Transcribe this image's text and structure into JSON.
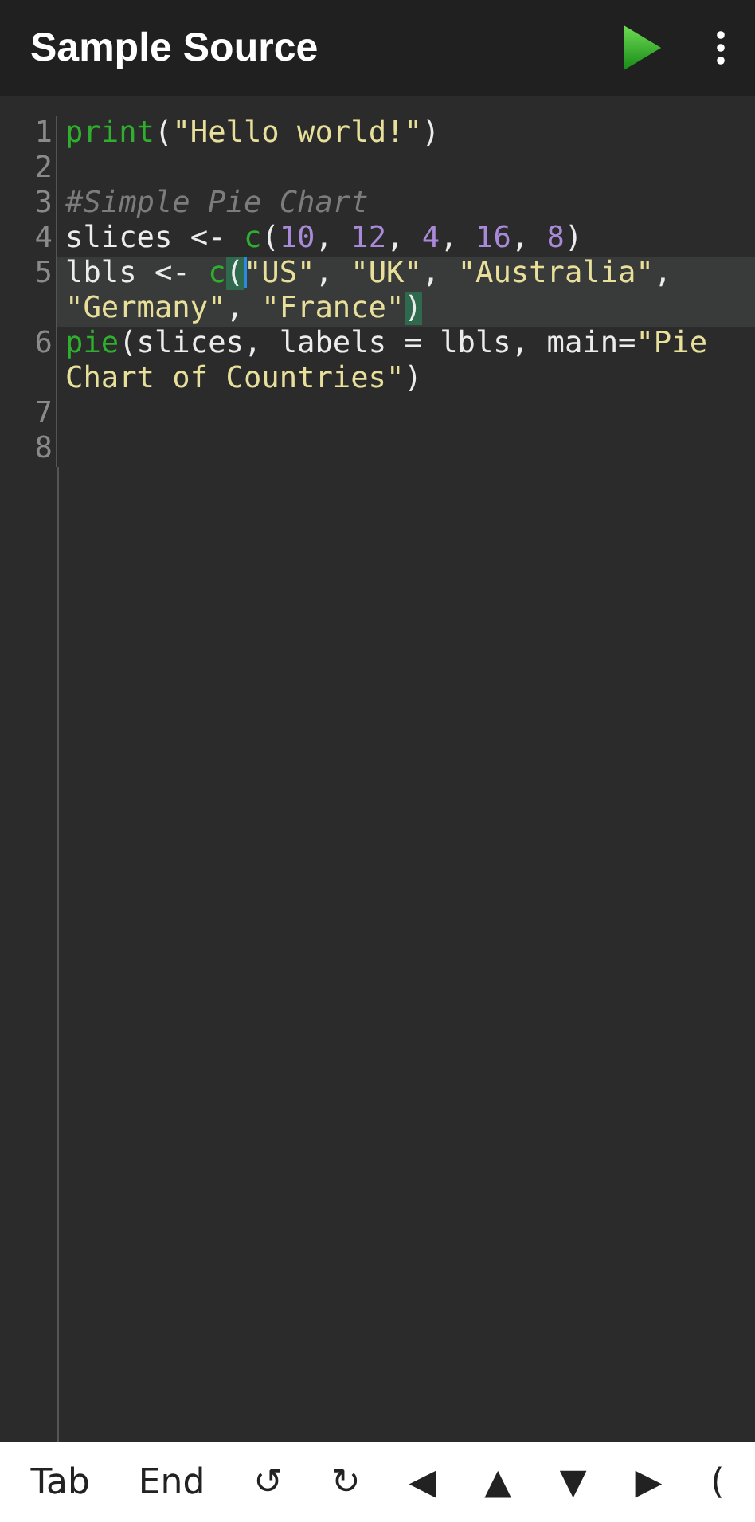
{
  "app_bar": {
    "title": "Sample Source"
  },
  "editor": {
    "lines": [
      {
        "number": "1",
        "current": false,
        "tokens": [
          {
            "kind": "function",
            "text": "print"
          },
          {
            "kind": "plain",
            "text": "("
          },
          {
            "kind": "string",
            "text": "\"Hello world!\""
          },
          {
            "kind": "plain",
            "text": ")"
          }
        ]
      },
      {
        "number": "2",
        "current": false
      },
      {
        "number": "3",
        "current": false,
        "tokens": [
          {
            "kind": "comment",
            "text": "#Simple Pie Chart"
          }
        ]
      },
      {
        "number": "4",
        "current": false,
        "tokens": [
          {
            "kind": "plain",
            "text": "slices <- "
          },
          {
            "kind": "function",
            "text": "c"
          },
          {
            "kind": "plain",
            "text": "("
          },
          {
            "kind": "number",
            "text": "10"
          },
          {
            "kind": "plain",
            "text": ", "
          },
          {
            "kind": "number",
            "text": "12"
          },
          {
            "kind": "plain",
            "text": ", "
          },
          {
            "kind": "number",
            "text": "4"
          },
          {
            "kind": "plain",
            "text": ", "
          },
          {
            "kind": "number",
            "text": "16"
          },
          {
            "kind": "plain",
            "text": ", "
          },
          {
            "kind": "number",
            "text": "8"
          },
          {
            "kind": "plain",
            "text": ")"
          }
        ]
      },
      {
        "number": "5",
        "current": true,
        "tokens": [
          {
            "kind": "plain",
            "text": "lbls <- "
          },
          {
            "kind": "function",
            "text": "c"
          },
          {
            "kind": "matched-bracket",
            "text": "("
          },
          {
            "kind": "cursor"
          },
          {
            "kind": "string",
            "text": "\"US\""
          },
          {
            "kind": "plain",
            "text": ", "
          },
          {
            "kind": "string",
            "text": "\"UK\""
          },
          {
            "kind": "plain",
            "text": ", "
          },
          {
            "kind": "string",
            "text": "\"Australia\""
          },
          {
            "kind": "plain",
            "text": ", "
          },
          {
            "kind": "string",
            "text": "\"Germany\""
          },
          {
            "kind": "plain",
            "text": ", "
          },
          {
            "kind": "string",
            "text": "\"France\""
          },
          {
            "kind": "matched-bracket",
            "text": ")"
          }
        ]
      },
      {
        "number": "6",
        "current": false,
        "tokens": [
          {
            "kind": "function",
            "text": "pie"
          },
          {
            "kind": "plain",
            "text": "(slices, labels = lbls, main="
          },
          {
            "kind": "string",
            "text": "\"Pie Chart of Countries\""
          },
          {
            "kind": "plain",
            "text": ")"
          }
        ]
      },
      {
        "number": "7",
        "current": false
      },
      {
        "number": "8",
        "current": false
      }
    ]
  },
  "key_bar": {
    "keys": [
      "Tab",
      "End",
      "↺",
      "↻",
      "◀",
      "▲",
      "▼",
      "▶",
      "("
    ]
  }
}
